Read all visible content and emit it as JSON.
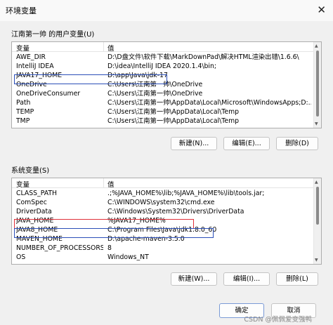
{
  "window": {
    "title": "环境变量"
  },
  "user_vars": {
    "group_label": "江南第一帅 的用户变量(U)",
    "header": {
      "variable": "变量",
      "value": "值"
    },
    "rows": [
      {
        "name": "AWE_DIR",
        "value": "D:\\D盘文件\\软件下载\\MarkDownPad\\解决HTML渲染出错\\1.6.6\\"
      },
      {
        "name": "IntelliJ IDEA",
        "value": "D:\\idea\\IntelliJ IDEA 2020.1.4\\bin;"
      },
      {
        "name": "JAVA17_HOME",
        "value": "D:\\app\\Java\\jdk-17"
      },
      {
        "name": "OneDrive",
        "value": "C:\\Users\\江南第一帅\\OneDrive"
      },
      {
        "name": "OneDriveConsumer",
        "value": "C:\\Users\\江南第一帅\\OneDrive"
      },
      {
        "name": "Path",
        "value": "C:\\Users\\江南第一帅\\AppData\\Local\\Microsoft\\WindowsApps;D:..."
      },
      {
        "name": "TEMP",
        "value": "C:\\Users\\江南第一帅\\AppData\\Local\\Temp"
      },
      {
        "name": "TMP",
        "value": "C:\\Users\\江南第一帅\\AppData\\Local\\Temp"
      }
    ],
    "buttons": {
      "new": "新建(N)...",
      "edit": "编辑(E)...",
      "delete": "删除(D)"
    }
  },
  "system_vars": {
    "group_label": "系统变量(S)",
    "header": {
      "variable": "变量",
      "value": "值"
    },
    "rows": [
      {
        "name": "CLASS_PATH",
        "value": ".;%JAVA_HOME%\\lib;%JAVA_HOME%\\lib\\tools.jar;"
      },
      {
        "name": "ComSpec",
        "value": "C:\\WINDOWS\\system32\\cmd.exe"
      },
      {
        "name": "DriverData",
        "value": "C:\\Windows\\System32\\Drivers\\DriverData"
      },
      {
        "name": "JAVA_HOME",
        "value": "%JAVA17_HOME%"
      },
      {
        "name": "JAVA8_HOME",
        "value": "C:\\Program Files\\Java\\jdk1.8.0_60"
      },
      {
        "name": "MAVEN_HOME",
        "value": "D:\\apache-maven-3.5.0"
      },
      {
        "name": "NUMBER_OF_PROCESSORS",
        "value": "8"
      },
      {
        "name": "OS",
        "value": "Windows_NT"
      }
    ],
    "buttons": {
      "new": "新建(W)...",
      "edit": "编辑(I)...",
      "delete": "删除(L)"
    }
  },
  "footer": {
    "ok": "确定",
    "cancel": "取消"
  },
  "watermark": "CSDN @佩佩爱变强鸭",
  "colors": {
    "red_box": "#e0303a",
    "blue_box": "#2b4fb8"
  }
}
